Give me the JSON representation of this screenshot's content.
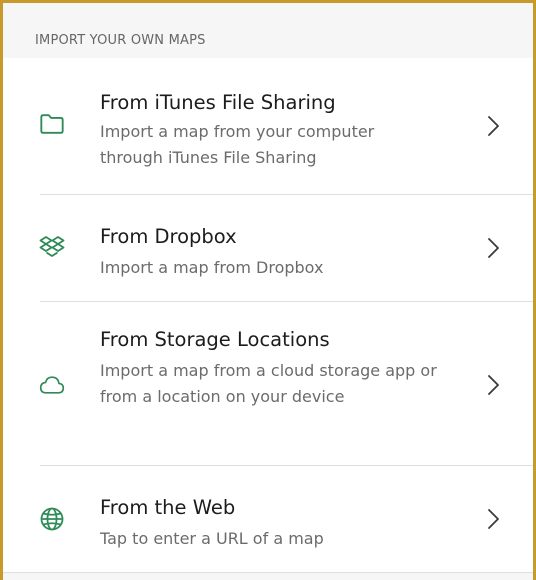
{
  "section": {
    "header": "IMPORT YOUR OWN MAPS"
  },
  "colors": {
    "accent": "#2e8b57",
    "frame": "#c89a2b"
  },
  "items": [
    {
      "icon": "folder-icon",
      "title": "From iTunes File Sharing",
      "subtitle": "Import a map from your computer through iTunes File Sharing"
    },
    {
      "icon": "dropbox-icon",
      "title": "From Dropbox",
      "subtitle": "Import a map from Dropbox"
    },
    {
      "icon": "cloud-icon",
      "title": "From Storage Locations",
      "subtitle": "Import a map from a cloud storage app or from a location on your device"
    },
    {
      "icon": "globe-icon",
      "title": "From the Web",
      "subtitle": "Tap to enter a URL of a map"
    }
  ]
}
